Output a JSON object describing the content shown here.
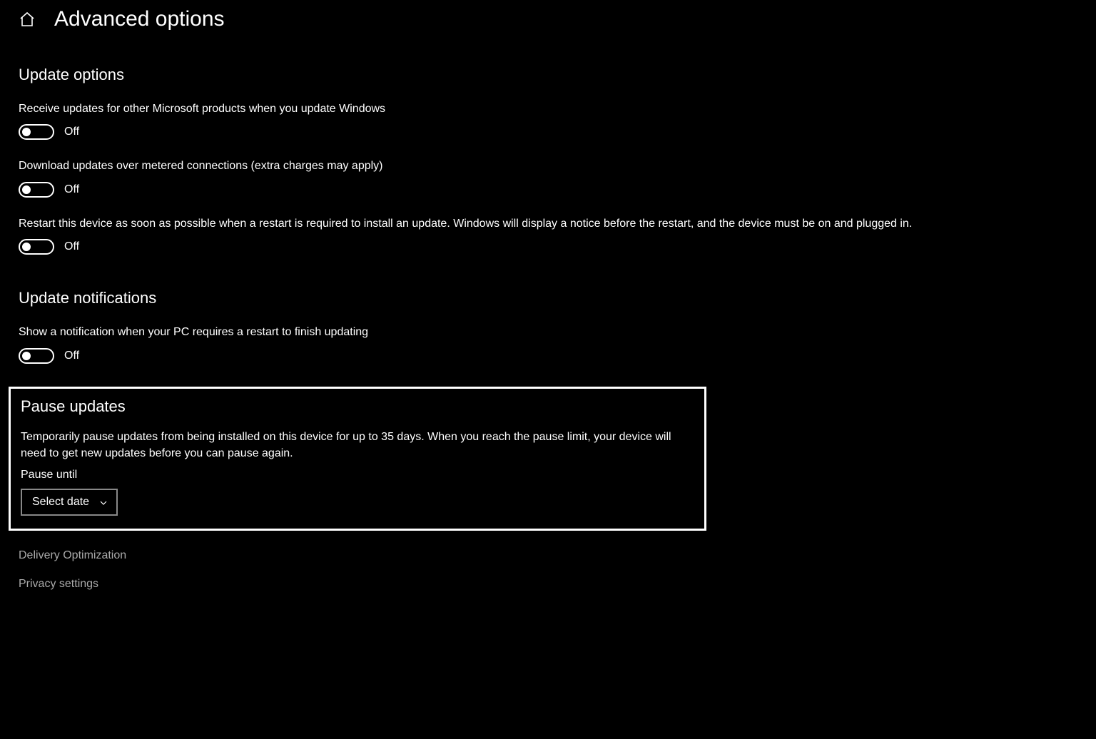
{
  "header": {
    "title": "Advanced options"
  },
  "sections": {
    "updateOptions": {
      "heading": "Update options",
      "receive": {
        "label": "Receive updates for other Microsoft products when you update Windows",
        "state": "Off"
      },
      "metered": {
        "label": "Download updates over metered connections (extra charges may apply)",
        "state": "Off"
      },
      "restart": {
        "label": "Restart this device as soon as possible when a restart is required to install an update. Windows will display a notice before the restart, and the device must be on and plugged in.",
        "state": "Off"
      }
    },
    "updateNotifications": {
      "heading": "Update notifications",
      "showNotification": {
        "label": "Show a notification when your PC requires a restart to finish updating",
        "state": "Off"
      }
    },
    "pauseUpdates": {
      "heading": "Pause updates",
      "description": "Temporarily pause updates from being installed on this device for up to 35 days. When you reach the pause limit, your device will need to get new updates before you can pause again.",
      "pauseUntilLabel": "Pause until",
      "selectPlaceholder": "Select date"
    }
  },
  "links": {
    "deliveryOptimization": "Delivery Optimization",
    "privacySettings": "Privacy settings"
  }
}
